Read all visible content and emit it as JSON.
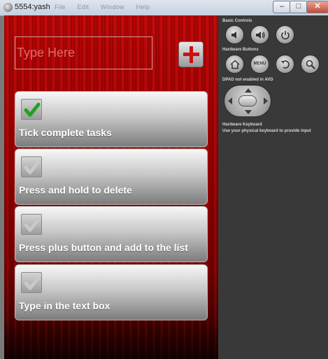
{
  "window": {
    "title": "5554:yash",
    "ghost_menu": [
      "File",
      "Edit",
      "Window",
      "Help"
    ],
    "minimize": "–",
    "maximize": "□",
    "close": "✕"
  },
  "app": {
    "input_placeholder": "Type Here",
    "tasks": [
      {
        "label": "Tick complete tasks",
        "checked": true
      },
      {
        "label": "Press and hold to delete",
        "checked": false
      },
      {
        "label": "Press plus button and add to the list",
        "checked": false
      },
      {
        "label": "Type in the text box",
        "checked": false
      }
    ],
    "accent_color": "#cc1111",
    "check_color": "#1fa31f"
  },
  "controls": {
    "basic_title": "Basic Controls",
    "hardware_title": "Hardware Buttons",
    "menu_label": "MENU",
    "dpad_note": "DPAD not enabled in AVD",
    "keyboard_title": "Hardware Keyboard",
    "keyboard_note": "Use your physical keyboard to provide input"
  }
}
